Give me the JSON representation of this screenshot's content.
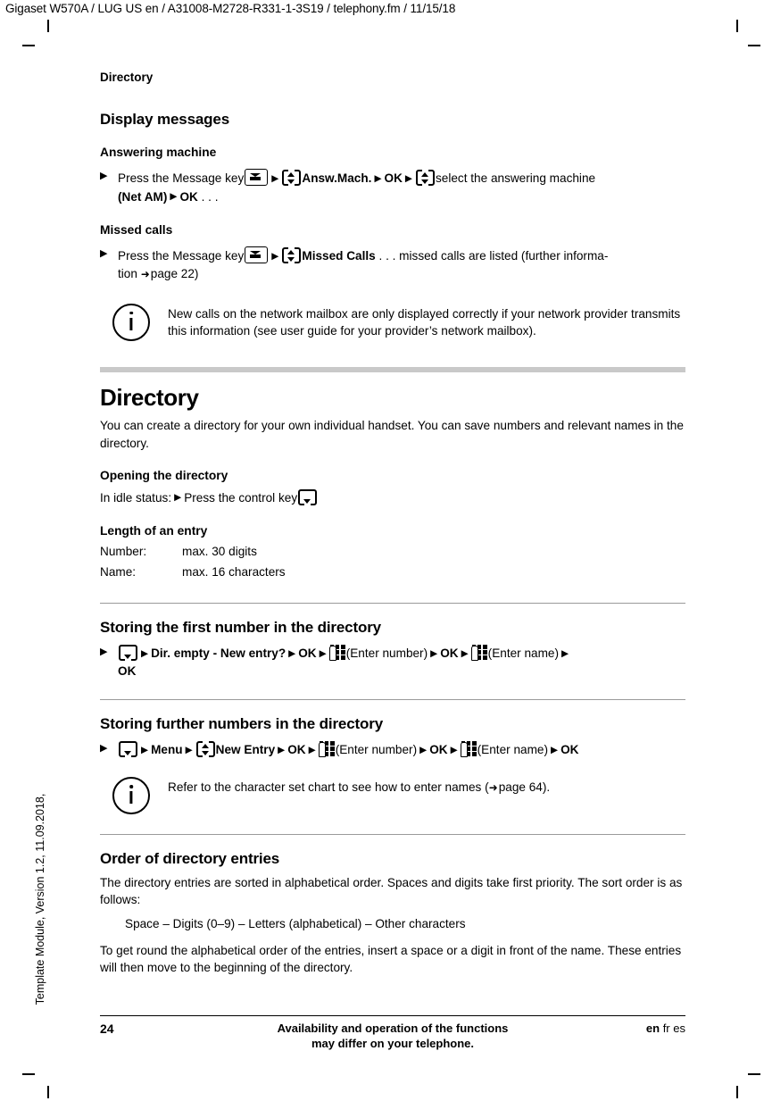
{
  "header": {
    "running_title": "Gigaset W570A / LUG US en / A31008-M2728-R331-1-3S19 / telephony.fm / 11/15/18"
  },
  "side_note": "Template Module, Version 1.2, 11.09.2018,",
  "chapter_label": "Directory",
  "display_messages": {
    "heading": "Display messages",
    "answering_machine": {
      "heading": "Answering machine",
      "text_1": "Press the Message key",
      "label_answ_mach": "Answ.Mach.",
      "label_ok_1": "OK",
      "text_2": "select the answering machine",
      "label_net_am": "(Net AM)",
      "label_ok_2": "OK",
      "ellipsis": ". . ."
    },
    "missed_calls": {
      "heading": "Missed calls",
      "text_1": "Press the Message key",
      "label_missed_calls": "Missed Calls",
      "text_2": ". . . missed calls are listed (further informa-",
      "text_3": "tion",
      "page_ref": "page 22)"
    },
    "note": "New calls on the network mailbox are only displayed correctly if your network provider transmits this information (see user guide for your provider’s network mailbox)."
  },
  "directory": {
    "title": "Directory",
    "intro": "You can create a directory for your own individual handset. You can save numbers and relevant names in the directory.",
    "opening": {
      "heading": "Opening the directory",
      "text": "In idle status:",
      "action": "Press the control key"
    },
    "length": {
      "heading": "Length of an entry",
      "rows": [
        {
          "label": "Number:",
          "value": "max. 30 digits"
        },
        {
          "label": "Name:",
          "value": "max. 16 characters"
        }
      ]
    },
    "storing_first": {
      "heading": "Storing the first number in the directory",
      "label_prompt": "Dir. empty - New entry?",
      "label_ok_1": "OK",
      "label_enter_number": "(Enter number)",
      "label_ok_2": "OK",
      "label_enter_name": "(Enter name)",
      "label_ok_3": "OK"
    },
    "storing_further": {
      "heading": "Storing further numbers in the directory",
      "label_menu": "Menu",
      "label_new_entry": "New Entry",
      "label_ok_1": "OK",
      "label_enter_number": "(Enter number)",
      "label_ok_2": "OK",
      "label_enter_name": "(Enter name)",
      "label_ok_3": "OK"
    },
    "note": "Refer to the character set chart to see how to enter names (",
    "note_page_ref": "page 64).",
    "order": {
      "heading": "Order of directory entries",
      "para_1": "The directory entries are sorted in alphabetical order. Spaces and digits take first priority. The sort order is as follows:",
      "sort_list": "Space – Digits (0–9) – Letters (alphabetical) – Other characters",
      "para_2": "To get round the alphabetical order of the entries, insert a space or a digit in front of the name. These entries will then move to the beginning of the directory."
    }
  },
  "footer": {
    "page_number": "24",
    "center_line_1": "Availability and operation of the functions",
    "center_line_2": "may differ on your telephone.",
    "lang_current": "en",
    "lang_other_1": "fr",
    "lang_other_2": "es"
  },
  "glyphs": {
    "bullet_triangle": "▶",
    "separator_triangle": "▶",
    "page_arrow": "➜"
  },
  "colors": {
    "text": "#000000",
    "gray_rule": "#c9c9c9",
    "thin_rule": "#9a9a9a"
  }
}
